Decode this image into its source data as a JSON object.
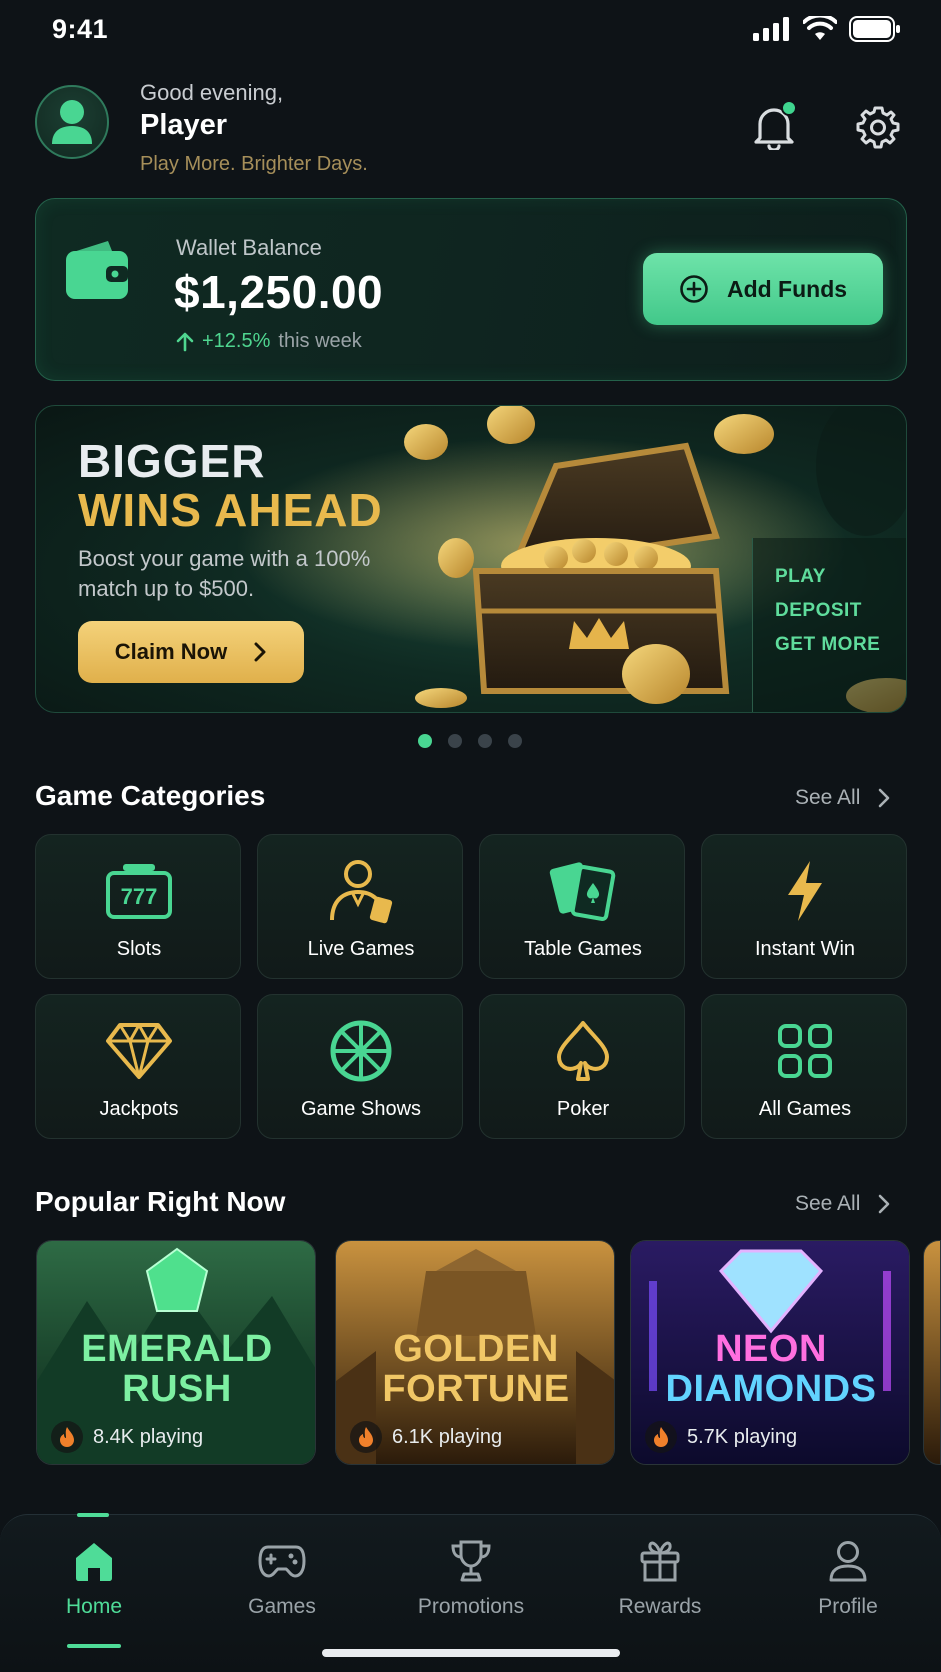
{
  "status_bar": {
    "time": "9:41"
  },
  "header": {
    "greeting": "Good evening,",
    "player_name": "Player",
    "tagline": "Play More. Brighter Days.",
    "icons": [
      "user-icon",
      "bell-icon",
      "gear-icon"
    ]
  },
  "wallet": {
    "label": "Wallet Balance",
    "amount": "$1,250.00",
    "change_pct": "+12.5%",
    "change_suffix": "this week",
    "add_funds_label": "Add Funds"
  },
  "promo": {
    "title_line1": "BIGGER",
    "title_line2": "WINS AHEAD",
    "description": "Boost your game with a 100% match up to $500.",
    "cta_label": "Claim Now",
    "side_items": [
      "PLAY",
      "DEPOSIT",
      "GET MORE"
    ],
    "slides_total": 4,
    "active_slide": 1
  },
  "categories": {
    "title": "Game Categories",
    "see_all": "See All",
    "items": [
      {
        "label": "Slots",
        "icon": "slot-machine-icon"
      },
      {
        "label": "Live Games",
        "icon": "live-dealer-icon"
      },
      {
        "label": "Table Games",
        "icon": "playing-cards-icon"
      },
      {
        "label": "Instant Win",
        "icon": "lightning-icon"
      },
      {
        "label": "Jackpots",
        "icon": "diamond-icon"
      },
      {
        "label": "Game Shows",
        "icon": "wheel-icon"
      },
      {
        "label": "Poker",
        "icon": "spade-icon"
      },
      {
        "label": "All Games",
        "icon": "grid-icon"
      }
    ]
  },
  "popular": {
    "title": "Popular Right Now",
    "see_all": "See All",
    "games": [
      {
        "title_line1": "EMERALD",
        "title_line2": "RUSH",
        "playing": "8.4K playing"
      },
      {
        "title_line1": "GOLDEN",
        "title_line2": "FORTUNE",
        "playing": "6.1K playing"
      },
      {
        "title_line1": "NEON",
        "title_line2": "DIAMONDS",
        "playing": "5.7K playing"
      }
    ]
  },
  "bottom_nav": {
    "items": [
      {
        "label": "Home",
        "icon": "home-icon",
        "active": true
      },
      {
        "label": "Games",
        "icon": "gamepad-icon",
        "active": false
      },
      {
        "label": "Promotions",
        "icon": "trophy-icon",
        "active": false
      },
      {
        "label": "Rewards",
        "icon": "gift-icon",
        "active": false
      },
      {
        "label": "Profile",
        "icon": "person-icon",
        "active": false
      }
    ]
  },
  "colors": {
    "accent_green": "#49d692",
    "accent_gold": "#e8b94d",
    "background": "#0e1317"
  }
}
